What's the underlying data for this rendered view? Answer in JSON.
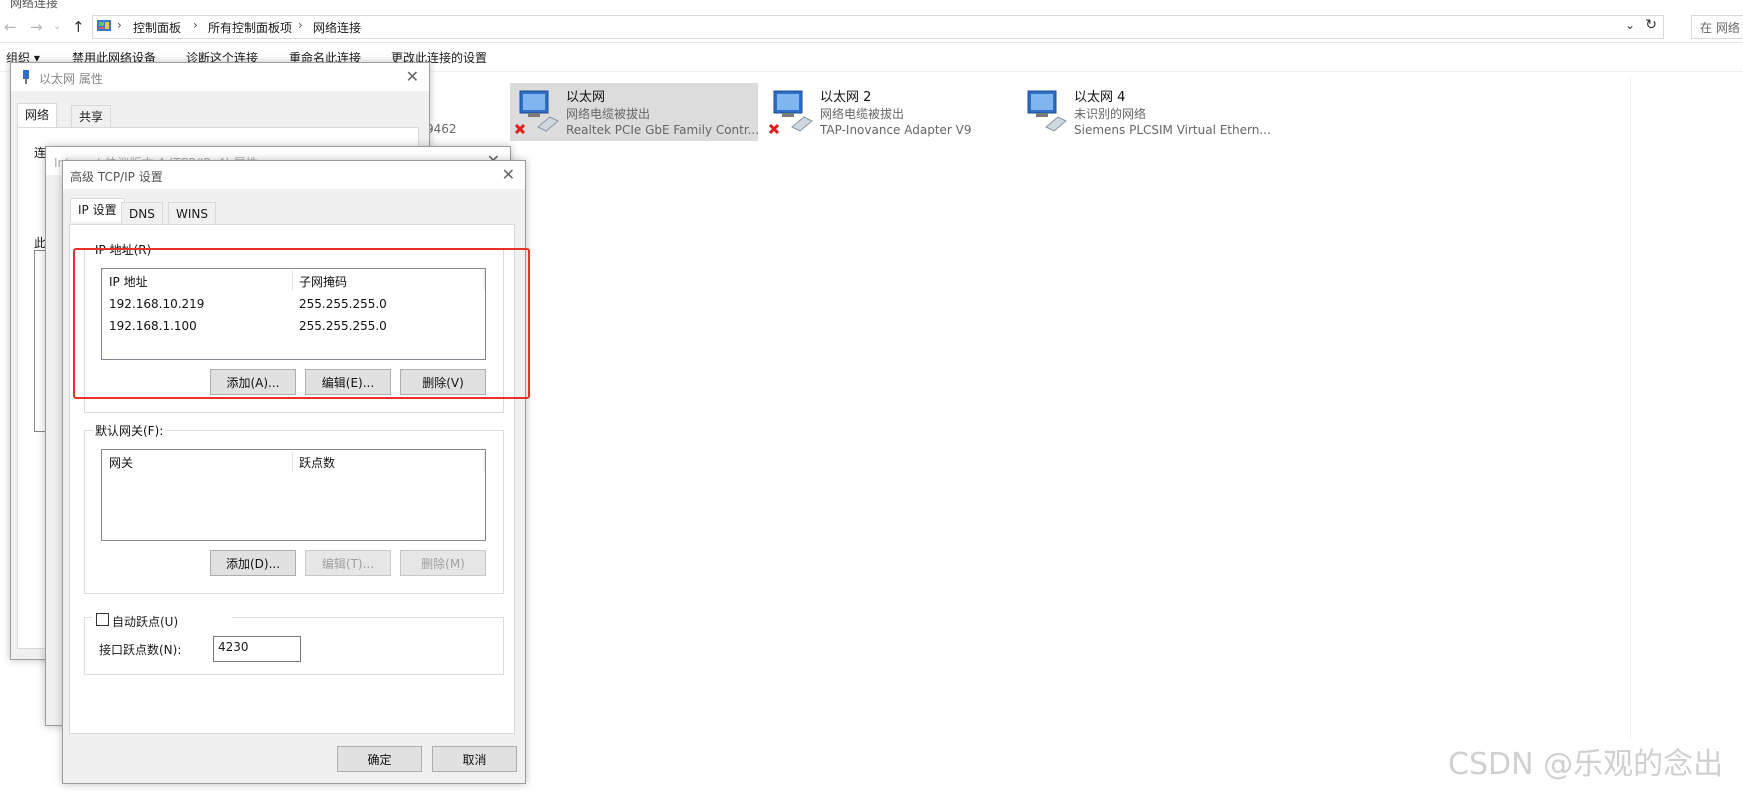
{
  "explorer": {
    "window_title": "网络连接",
    "breadcrumb": [
      "控制面板",
      "所有控制面板项",
      "网络连接"
    ],
    "search_placeholder": "在 网络",
    "command_bar": [
      "组织 ▾",
      "禁用此网络设备",
      "诊断这个连接",
      "重命名此连接",
      "更改此连接的设置"
    ],
    "partial_text": "9462",
    "adapters": [
      {
        "name": "以太网",
        "status": "网络电缆被拔出",
        "device": "Realtek PCIe GbE Family Contr...",
        "disconnected": true,
        "selected": true
      },
      {
        "name": "以太网 2",
        "status": "网络电缆被拔出",
        "device": "TAP-Inovance Adapter V9",
        "disconnected": true,
        "selected": false
      },
      {
        "name": "以太网 4",
        "status": "未识别的网络",
        "device": "Siemens PLCSIM Virtual Ethern...",
        "disconnected": false,
        "selected": false
      }
    ]
  },
  "ethernet_props": {
    "title": "以太网 属性",
    "tabs": [
      "网络",
      "共享"
    ],
    "partial_labels": [
      "连",
      "此"
    ]
  },
  "ipv4_props": {
    "title": "Internet 协议版本 4 (TCP/IPv4) 属性"
  },
  "advanced": {
    "title": "高级 TCP/IP 设置",
    "tabs": [
      "IP 设置",
      "DNS",
      "WINS"
    ],
    "ip_group_label": "IP 地址(R)",
    "ip_columns": [
      "IP 地址",
      "子网掩码"
    ],
    "ip_rows": [
      [
        "192.168.10.219",
        "255.255.255.0"
      ],
      [
        "192.168.1.100",
        "255.255.255.0"
      ]
    ],
    "ip_buttons": {
      "add": "添加(A)...",
      "edit": "编辑(E)...",
      "remove": "删除(V)"
    },
    "gw_group_label": "默认网关(F):",
    "gw_columns": [
      "网关",
      "跃点数"
    ],
    "gw_buttons": {
      "add": "添加(D)...",
      "edit": "编辑(T)...",
      "remove": "删除(M)"
    },
    "auto_metric_label": "自动跃点(U)",
    "auto_metric_checked": false,
    "interface_metric_label": "接口跃点数(N):",
    "interface_metric_value": "4230",
    "ok": "确定",
    "cancel": "取消"
  },
  "watermark": "CSDN @乐观的念出"
}
